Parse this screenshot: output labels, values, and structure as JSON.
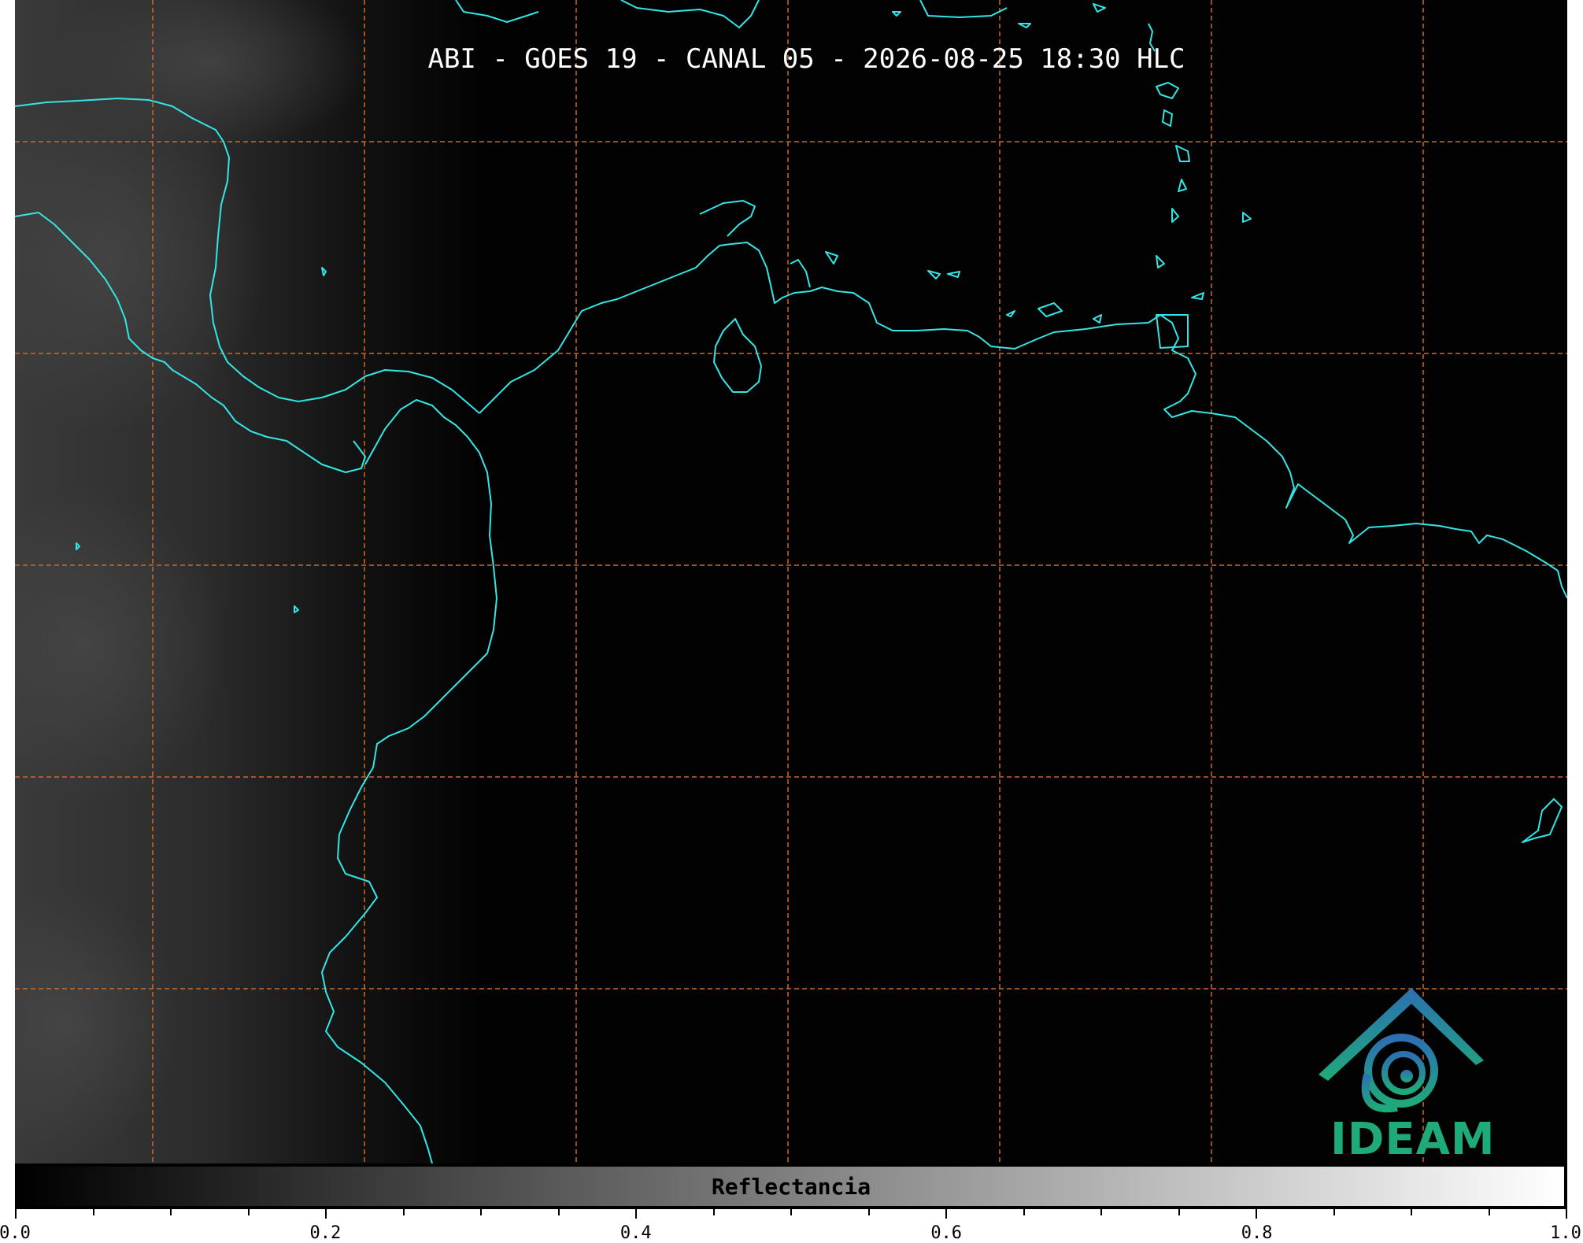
{
  "title": "ABI - GOES 19 - CANAL 05 - 2026-08-25 18:30 HLC",
  "colorbar": {
    "label": "Reflectancia",
    "ticks": [
      "0.0",
      "0.2",
      "0.4",
      "0.6",
      "0.8",
      "1.0"
    ],
    "range": [
      0.0,
      1.0
    ],
    "cmap": "grayscale black-to-white"
  },
  "logo": {
    "text": "IDEAM",
    "color": "#1faa7a"
  },
  "colors": {
    "coastline": "#33e5e5",
    "gridlines": "#d2691e",
    "background": "#020202"
  }
}
